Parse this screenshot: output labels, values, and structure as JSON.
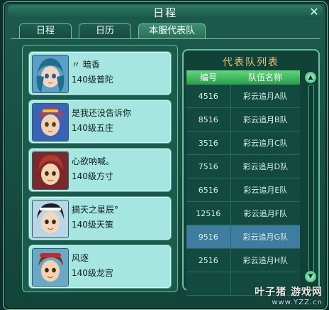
{
  "window": {
    "title": "日程"
  },
  "tabs": [
    {
      "label": "日程"
    },
    {
      "label": "日历"
    },
    {
      "label": "本服代表队"
    }
  ],
  "players": [
    {
      "name": "〃 暗香",
      "info": "140级普陀"
    },
    {
      "name": "是我还没告诉你",
      "info": "140级五庄"
    },
    {
      "name": "心欲呐喊。",
      "info": "140级方寸"
    },
    {
      "name": "摘天之星辰°",
      "info": "140级天策"
    },
    {
      "name": "风逐",
      "info": "140级龙宫"
    }
  ],
  "team_list": {
    "title": "代表队列表",
    "headers": {
      "number": "编号",
      "name": "队伍名称"
    },
    "rows": [
      {
        "number": "4516",
        "name": "彩云追月A队"
      },
      {
        "number": "8516",
        "name": "彩云追月B队"
      },
      {
        "number": "3516",
        "name": "彩云追月C队"
      },
      {
        "number": "7516",
        "name": "彩云追月D队"
      },
      {
        "number": "6516",
        "name": "彩云追月E队"
      },
      {
        "number": "12516",
        "name": "彩云追月F队"
      },
      {
        "number": "9516",
        "name": "彩云追月G队"
      },
      {
        "number": "2516",
        "name": "彩云追月H队"
      },
      {
        "number": "",
        "name": ""
      }
    ]
  },
  "watermark": {
    "brand": "叶子猪 游戏网",
    "url": "www.YZZ.cn"
  }
}
